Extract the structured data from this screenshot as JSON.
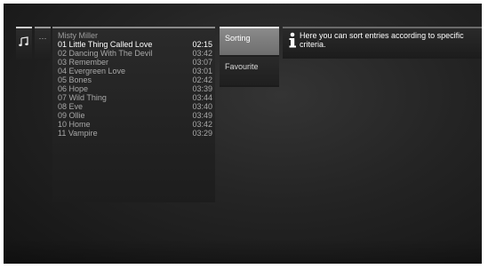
{
  "window": {
    "icons": {
      "music": "music-note-icon",
      "more": "ellipsis-icon",
      "info": "info-icon"
    },
    "more_label": "···"
  },
  "album": {
    "title": "Misty Miller",
    "tracks": [
      {
        "name": "01 Little Thing Called Love",
        "duration": "02:15",
        "selected": true
      },
      {
        "name": "02 Dancing With The Devil",
        "duration": "03:42"
      },
      {
        "name": "03 Remember",
        "duration": "03:07"
      },
      {
        "name": "04 Evergreen Love",
        "duration": "03:01"
      },
      {
        "name": "05 Bones",
        "duration": "02:42"
      },
      {
        "name": "06 Hope",
        "duration": "03:39"
      },
      {
        "name": "07 Wild Thing",
        "duration": "03:44"
      },
      {
        "name": "08 Eve",
        "duration": "03:40"
      },
      {
        "name": "09 Ollie",
        "duration": "03:49"
      },
      {
        "name": "10 Home",
        "duration": "03:42"
      },
      {
        "name": "11 Vampire",
        "duration": "03:29"
      }
    ]
  },
  "options": {
    "sorting_label": "Sorting",
    "favourite_label": "Favourite"
  },
  "info": {
    "text": "Here you can sort entries according to specific criteria."
  }
}
